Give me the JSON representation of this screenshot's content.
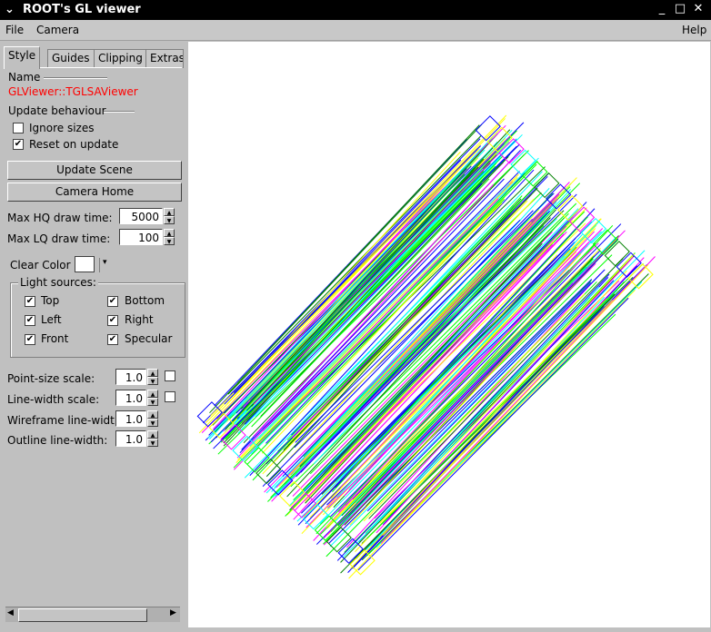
{
  "window": {
    "title": "ROOT's GL viewer",
    "icon": "chevron-down-icon",
    "minimize": "_",
    "maximize": "□",
    "close": "✕"
  },
  "menu": {
    "file": "File",
    "camera": "Camera",
    "help": "Help"
  },
  "tabs": [
    "Style",
    "Guides",
    "Clipping",
    "Extras"
  ],
  "style": {
    "name_label": "Name",
    "name_value": "GLViewer::TGLSAViewer",
    "update_behaviour": "Update behaviour",
    "ignore_sizes": "Ignore sizes",
    "ignore_sizes_checked": false,
    "reset_on_update": "Reset on update",
    "reset_on_update_checked": true,
    "update_scene": "Update Scene",
    "camera_home": "Camera Home",
    "max_hq_label": "Max HQ draw time:",
    "max_hq_value": "5000",
    "max_lq_label": "Max LQ draw time:",
    "max_lq_value": "100",
    "clear_color_label": "Clear Color",
    "clear_color": "#ffffff",
    "light_sources": "Light sources:",
    "lights": {
      "top": "Top",
      "bottom": "Bottom",
      "left": "Left",
      "right": "Right",
      "front": "Front",
      "specular": "Specular"
    },
    "point_size_label": "Point-size scale:",
    "point_size_value": "1.0",
    "line_width_label": "Line-width scale:",
    "line_width_value": "1.0",
    "wireframe_label": "Wireframe line-width:",
    "wireframe_value": "1.0",
    "outline_label": "Outline line-width:",
    "outline_value": "1.0"
  },
  "colors": {
    "highlight": "#ff0000",
    "wire": [
      "#0000ff",
      "#ffff00",
      "#ff00ff",
      "#00ffff",
      "#00ff00",
      "#008000"
    ]
  }
}
